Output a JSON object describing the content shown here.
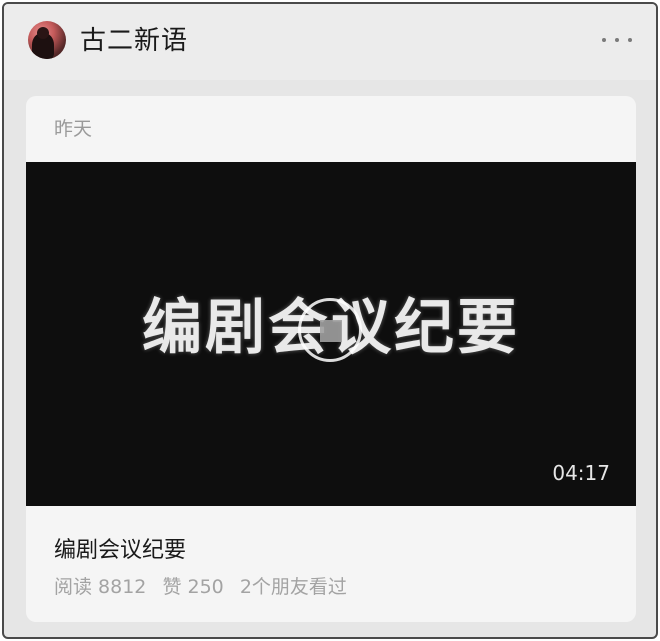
{
  "account": {
    "name": "古二新语",
    "avatar_icon": "avatar-icon",
    "more_icon": "more-dots-icon"
  },
  "post": {
    "date": "昨天",
    "video": {
      "overlay_text": "编剧会议纪要",
      "duration": "04:17",
      "play_icon": "play-icon"
    },
    "title": "编剧会议纪要",
    "stats": {
      "reads": "阅读 8812",
      "likes": "赞 250",
      "friends": "2个朋友看过"
    }
  },
  "colors": {
    "background": "#e6e6e6",
    "card": "#f5f5f5",
    "video_bg": "#0e0e0e",
    "muted_text": "#a3a3a3"
  }
}
